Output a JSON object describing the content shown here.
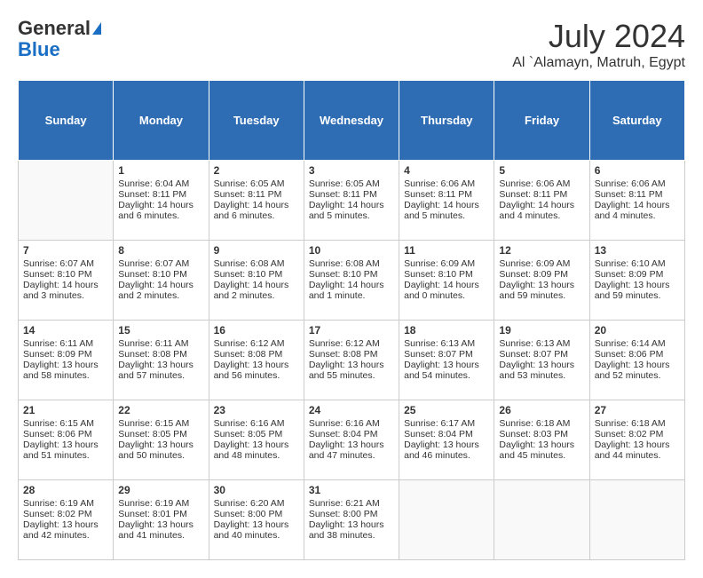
{
  "header": {
    "logo_line1": "General",
    "logo_line2": "Blue",
    "month_title": "July 2024",
    "location": "Al `Alamayn, Matruh, Egypt"
  },
  "days_of_week": [
    "Sunday",
    "Monday",
    "Tuesday",
    "Wednesday",
    "Thursday",
    "Friday",
    "Saturday"
  ],
  "weeks": [
    [
      {
        "day": "",
        "info": ""
      },
      {
        "day": "1",
        "info": "Sunrise: 6:04 AM\nSunset: 8:11 PM\nDaylight: 14 hours\nand 6 minutes."
      },
      {
        "day": "2",
        "info": "Sunrise: 6:05 AM\nSunset: 8:11 PM\nDaylight: 14 hours\nand 6 minutes."
      },
      {
        "day": "3",
        "info": "Sunrise: 6:05 AM\nSunset: 8:11 PM\nDaylight: 14 hours\nand 5 minutes."
      },
      {
        "day": "4",
        "info": "Sunrise: 6:06 AM\nSunset: 8:11 PM\nDaylight: 14 hours\nand 5 minutes."
      },
      {
        "day": "5",
        "info": "Sunrise: 6:06 AM\nSunset: 8:11 PM\nDaylight: 14 hours\nand 4 minutes."
      },
      {
        "day": "6",
        "info": "Sunrise: 6:06 AM\nSunset: 8:11 PM\nDaylight: 14 hours\nand 4 minutes."
      }
    ],
    [
      {
        "day": "7",
        "info": "Sunrise: 6:07 AM\nSunset: 8:10 PM\nDaylight: 14 hours\nand 3 minutes."
      },
      {
        "day": "8",
        "info": "Sunrise: 6:07 AM\nSunset: 8:10 PM\nDaylight: 14 hours\nand 2 minutes."
      },
      {
        "day": "9",
        "info": "Sunrise: 6:08 AM\nSunset: 8:10 PM\nDaylight: 14 hours\nand 2 minutes."
      },
      {
        "day": "10",
        "info": "Sunrise: 6:08 AM\nSunset: 8:10 PM\nDaylight: 14 hours\nand 1 minute."
      },
      {
        "day": "11",
        "info": "Sunrise: 6:09 AM\nSunset: 8:10 PM\nDaylight: 14 hours\nand 0 minutes."
      },
      {
        "day": "12",
        "info": "Sunrise: 6:09 AM\nSunset: 8:09 PM\nDaylight: 13 hours\nand 59 minutes."
      },
      {
        "day": "13",
        "info": "Sunrise: 6:10 AM\nSunset: 8:09 PM\nDaylight: 13 hours\nand 59 minutes."
      }
    ],
    [
      {
        "day": "14",
        "info": "Sunrise: 6:11 AM\nSunset: 8:09 PM\nDaylight: 13 hours\nand 58 minutes."
      },
      {
        "day": "15",
        "info": "Sunrise: 6:11 AM\nSunset: 8:08 PM\nDaylight: 13 hours\nand 57 minutes."
      },
      {
        "day": "16",
        "info": "Sunrise: 6:12 AM\nSunset: 8:08 PM\nDaylight: 13 hours\nand 56 minutes."
      },
      {
        "day": "17",
        "info": "Sunrise: 6:12 AM\nSunset: 8:08 PM\nDaylight: 13 hours\nand 55 minutes."
      },
      {
        "day": "18",
        "info": "Sunrise: 6:13 AM\nSunset: 8:07 PM\nDaylight: 13 hours\nand 54 minutes."
      },
      {
        "day": "19",
        "info": "Sunrise: 6:13 AM\nSunset: 8:07 PM\nDaylight: 13 hours\nand 53 minutes."
      },
      {
        "day": "20",
        "info": "Sunrise: 6:14 AM\nSunset: 8:06 PM\nDaylight: 13 hours\nand 52 minutes."
      }
    ],
    [
      {
        "day": "21",
        "info": "Sunrise: 6:15 AM\nSunset: 8:06 PM\nDaylight: 13 hours\nand 51 minutes."
      },
      {
        "day": "22",
        "info": "Sunrise: 6:15 AM\nSunset: 8:05 PM\nDaylight: 13 hours\nand 50 minutes."
      },
      {
        "day": "23",
        "info": "Sunrise: 6:16 AM\nSunset: 8:05 PM\nDaylight: 13 hours\nand 48 minutes."
      },
      {
        "day": "24",
        "info": "Sunrise: 6:16 AM\nSunset: 8:04 PM\nDaylight: 13 hours\nand 47 minutes."
      },
      {
        "day": "25",
        "info": "Sunrise: 6:17 AM\nSunset: 8:04 PM\nDaylight: 13 hours\nand 46 minutes."
      },
      {
        "day": "26",
        "info": "Sunrise: 6:18 AM\nSunset: 8:03 PM\nDaylight: 13 hours\nand 45 minutes."
      },
      {
        "day": "27",
        "info": "Sunrise: 6:18 AM\nSunset: 8:02 PM\nDaylight: 13 hours\nand 44 minutes."
      }
    ],
    [
      {
        "day": "28",
        "info": "Sunrise: 6:19 AM\nSunset: 8:02 PM\nDaylight: 13 hours\nand 42 minutes."
      },
      {
        "day": "29",
        "info": "Sunrise: 6:19 AM\nSunset: 8:01 PM\nDaylight: 13 hours\nand 41 minutes."
      },
      {
        "day": "30",
        "info": "Sunrise: 6:20 AM\nSunset: 8:00 PM\nDaylight: 13 hours\nand 40 minutes."
      },
      {
        "day": "31",
        "info": "Sunrise: 6:21 AM\nSunset: 8:00 PM\nDaylight: 13 hours\nand 38 minutes."
      },
      {
        "day": "",
        "info": ""
      },
      {
        "day": "",
        "info": ""
      },
      {
        "day": "",
        "info": ""
      }
    ]
  ]
}
